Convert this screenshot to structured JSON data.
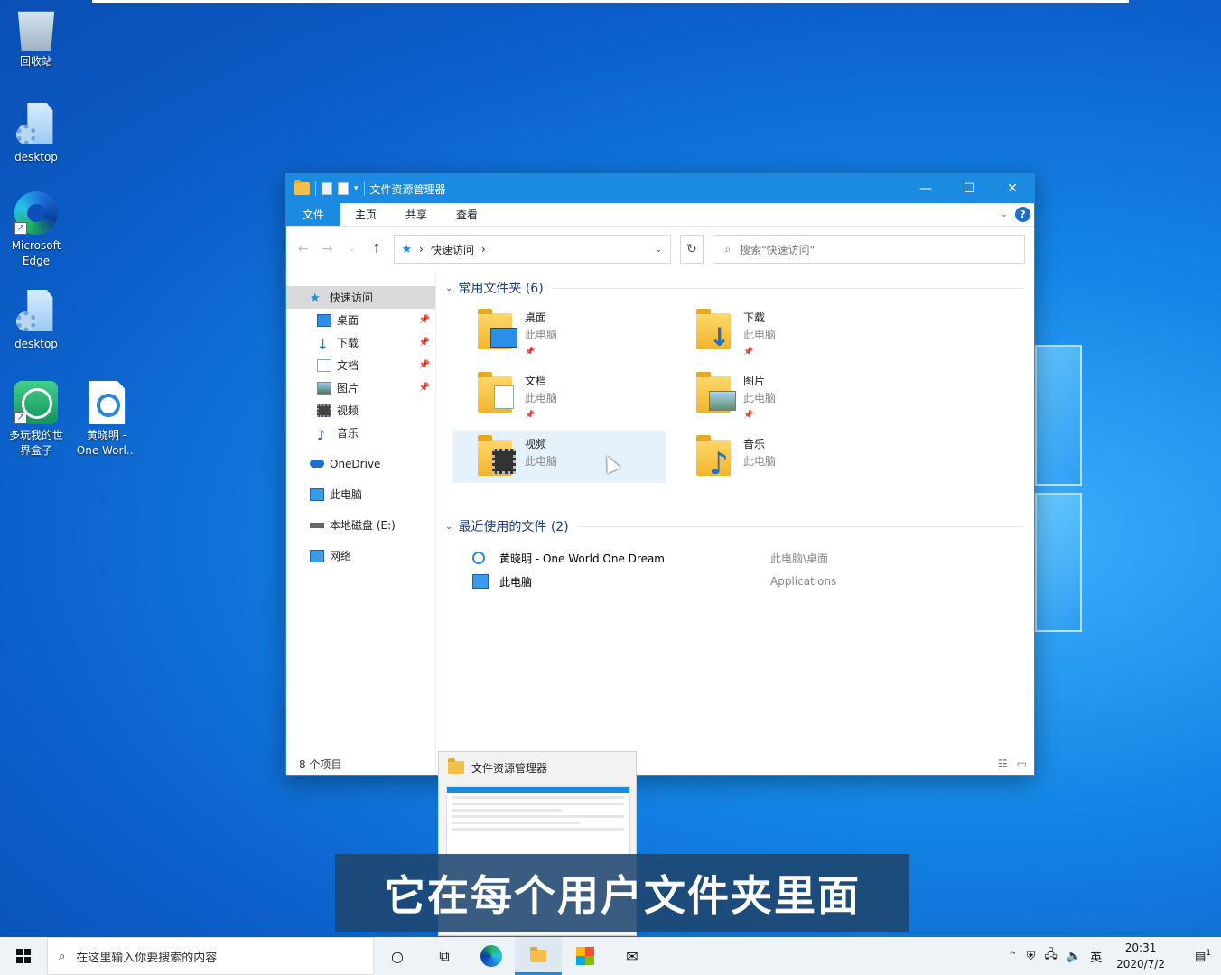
{
  "desktop": {
    "icons": [
      {
        "label": "回收站"
      },
      {
        "label": "desktop"
      },
      {
        "label_line1": "Microsoft",
        "label_line2": "Edge"
      },
      {
        "label": "desktop"
      },
      {
        "label_line1": "多玩我的世",
        "label_line2": "界盒子"
      },
      {
        "label_line1": "黄晓明 -",
        "label_line2": "One Worl..."
      }
    ]
  },
  "window": {
    "title": "文件资源管理器",
    "controls": {
      "minimize": "—",
      "maximize": "☐",
      "close": "✕"
    },
    "ribbon_tabs": [
      "文件",
      "主页",
      "共享",
      "查看"
    ],
    "address": {
      "location": "快速访问",
      "separator": "›"
    },
    "search_placeholder": "搜索\"快速访问\"",
    "nav": {
      "quick_access": "快速访问",
      "items": [
        "桌面",
        "下载",
        "文档",
        "图片",
        "视频",
        "音乐"
      ],
      "onedrive": "OneDrive",
      "this_pc": "此电脑",
      "local_disk": "本地磁盘 (E:)",
      "network": "网络"
    },
    "frequent": {
      "header": "常用文件夹 (6)",
      "folders": [
        {
          "name": "桌面",
          "location": "此电脑",
          "pinned": true
        },
        {
          "name": "下载",
          "location": "此电脑",
          "pinned": true
        },
        {
          "name": "文档",
          "location": "此电脑",
          "pinned": true
        },
        {
          "name": "图片",
          "location": "此电脑",
          "pinned": true
        },
        {
          "name": "视频",
          "location": "此电脑",
          "pinned": false
        },
        {
          "name": "音乐",
          "location": "此电脑",
          "pinned": false
        }
      ]
    },
    "recent": {
      "header": "最近使用的文件 (2)",
      "files": [
        {
          "name": "黄晓明 - One World One Dream",
          "path": "此电脑\\桌面"
        },
        {
          "name": "此电脑",
          "path": "Applications"
        }
      ]
    },
    "status": "8 个项目"
  },
  "thumbnail": {
    "title": "文件资源管理器"
  },
  "subtitle": "它在每个用户文件夹里面",
  "taskbar": {
    "search_placeholder": "在这里输入你要搜索的内容",
    "ime": "英",
    "time": "20:31",
    "date": "2020/7/2",
    "notifications": "1"
  },
  "colors": {
    "accent": "#1a8be0",
    "folder": "#f4c04a",
    "desktop": "#1487e6"
  }
}
